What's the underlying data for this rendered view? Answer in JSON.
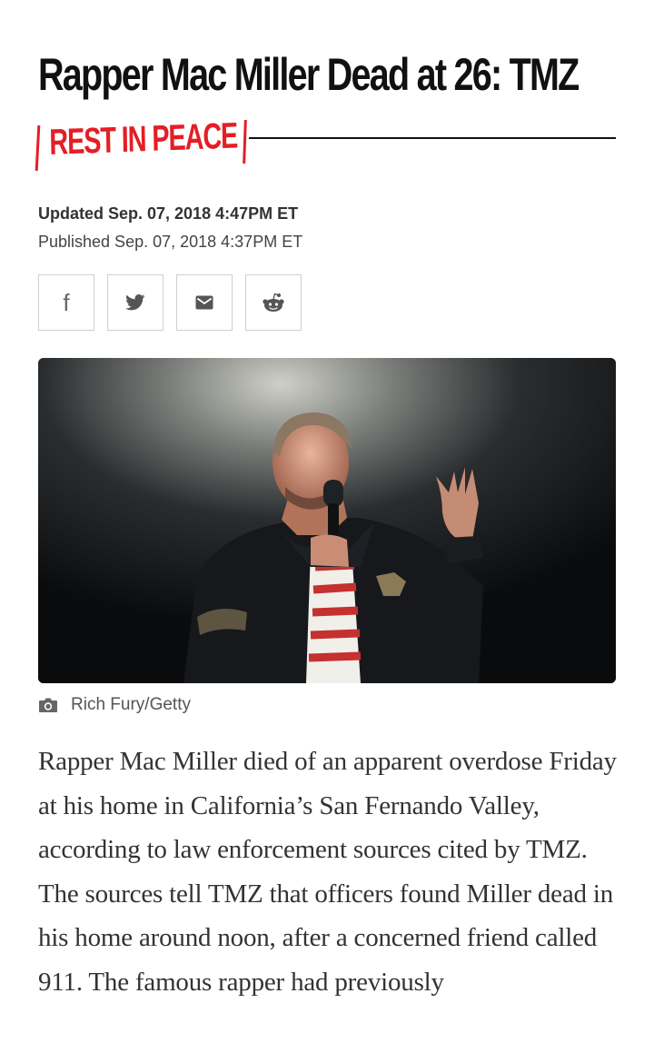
{
  "article": {
    "headline": "Rapper Mac Miller Dead at 26: TMZ",
    "flag": "REST IN PEACE",
    "updated": "Updated Sep. 07, 2018 4:47PM ET",
    "published": "Published Sep. 07, 2018 4:37PM ET",
    "photo_credit": "Rich Fury/Getty",
    "body": "Rapper Mac Miller died of an apparent overdose Friday at his home in California’s San Fernando Valley, according to law enforcement sources cited by TMZ.  The sources tell TMZ that officers found Miller dead in his home around noon, after a concerned friend called 911. The famous rapper had previously"
  },
  "share": {
    "buttons": [
      {
        "icon": "facebook-icon",
        "label": "f"
      },
      {
        "icon": "twitter-icon"
      },
      {
        "icon": "email-icon"
      },
      {
        "icon": "reddit-icon"
      }
    ]
  },
  "colors": {
    "accent": "#e41e26",
    "text": "#111111",
    "body_text": "#333333",
    "meta_text": "#444444",
    "border": "#cfcfcf"
  },
  "icons": {
    "credit": "camera-icon"
  }
}
